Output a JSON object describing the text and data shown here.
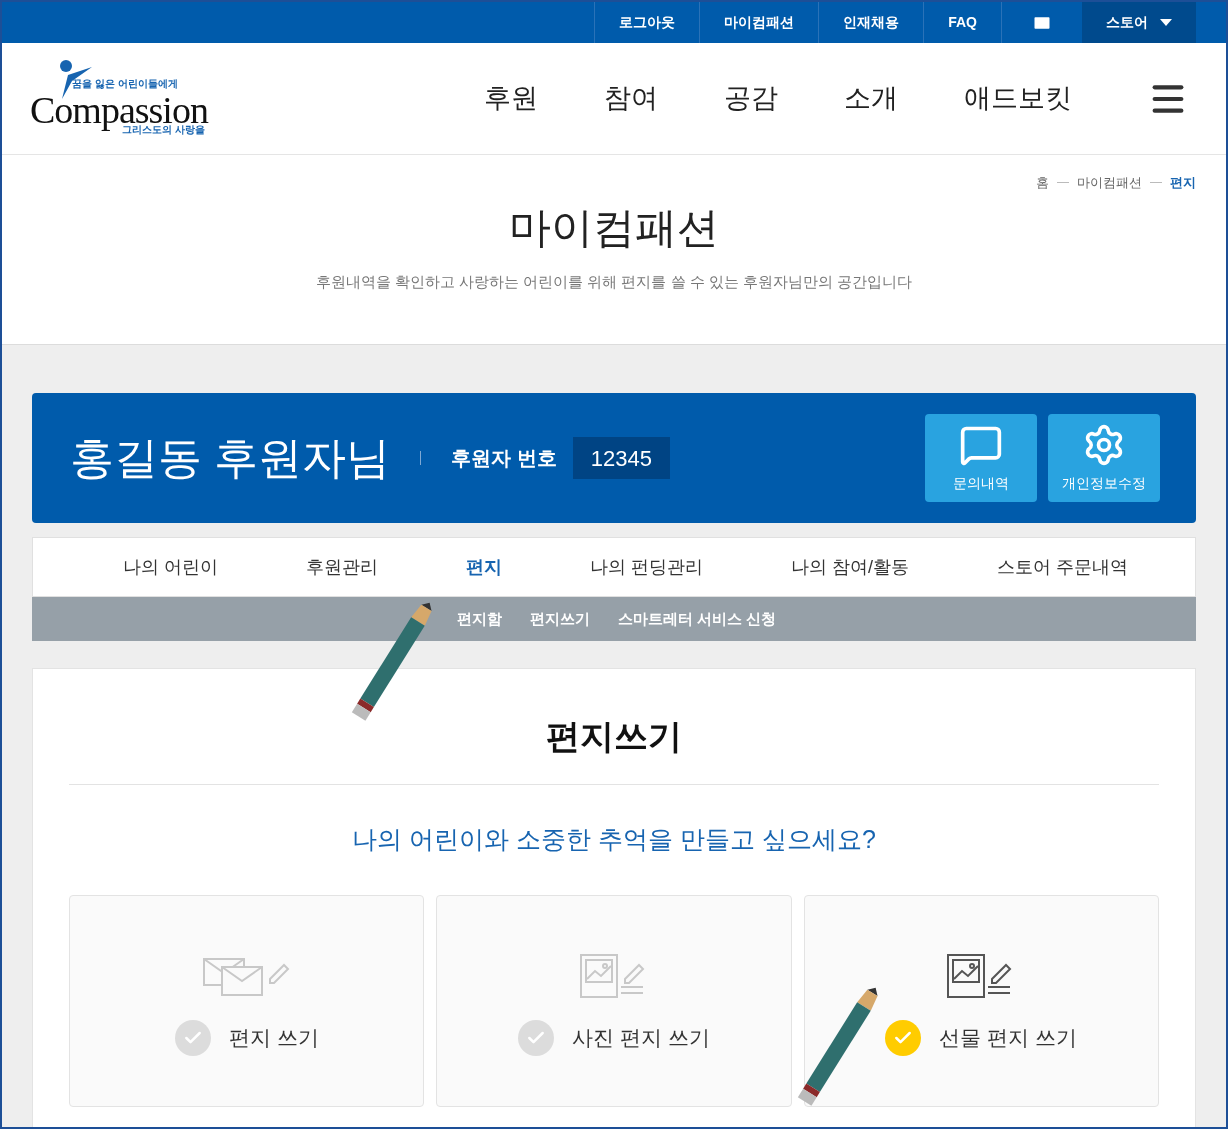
{
  "top_bar": {
    "links": [
      "로그아웃",
      "마이컴패션",
      "인재채용",
      "FAQ"
    ],
    "store": {
      "label": "스토어",
      "selected": true
    }
  },
  "logo": {
    "tagline_top": "꿈을 잃은 어린이들에게",
    "wordmark": "Compassion",
    "tagline_bottom": "그리스도의 사랑을"
  },
  "main_nav": [
    "후원",
    "참여",
    "공감",
    "소개",
    "애드보킷"
  ],
  "breadcrumb": [
    {
      "label": "홈",
      "selected": false
    },
    {
      "label": "마이컴패션",
      "selected": false
    },
    {
      "label": "편지",
      "selected": true
    }
  ],
  "page_title": "마이컴패션",
  "page_subtitle": "후원내역을 확인하고 사랑하는 어린이를 위해 편지를 쓸 수 있는 후원자님만의 공간입니다",
  "sponsor": {
    "name": "홍길동 후원자님",
    "number_label": "후원자 번호",
    "number": "12345",
    "buttons": [
      {
        "kind": "inquiry",
        "label": "문의내역"
      },
      {
        "kind": "settings",
        "label": "개인정보수정"
      }
    ]
  },
  "tabs": [
    {
      "label": "나의 어린이",
      "selected": false
    },
    {
      "label": "후원관리",
      "selected": false
    },
    {
      "label": "편지",
      "selected": true
    },
    {
      "label": "나의 펀딩관리",
      "selected": false
    },
    {
      "label": "나의 참여/활동",
      "selected": false
    },
    {
      "label": "스토어 주문내역",
      "selected": false
    }
  ],
  "sub_tabs": [
    "편지함",
    "편지쓰기",
    "스마트레터 서비스 신청"
  ],
  "section_title": "편지쓰기",
  "question": "나의 어린이와 소중한 추억을 만들고 싶으세요?",
  "options": [
    {
      "kind": "letter",
      "label": "편지 쓰기",
      "selected": false
    },
    {
      "kind": "photo",
      "label": "사진 편지 쓰기",
      "selected": false
    },
    {
      "kind": "gift",
      "label": "선물 편지 쓰기",
      "selected": true
    }
  ]
}
